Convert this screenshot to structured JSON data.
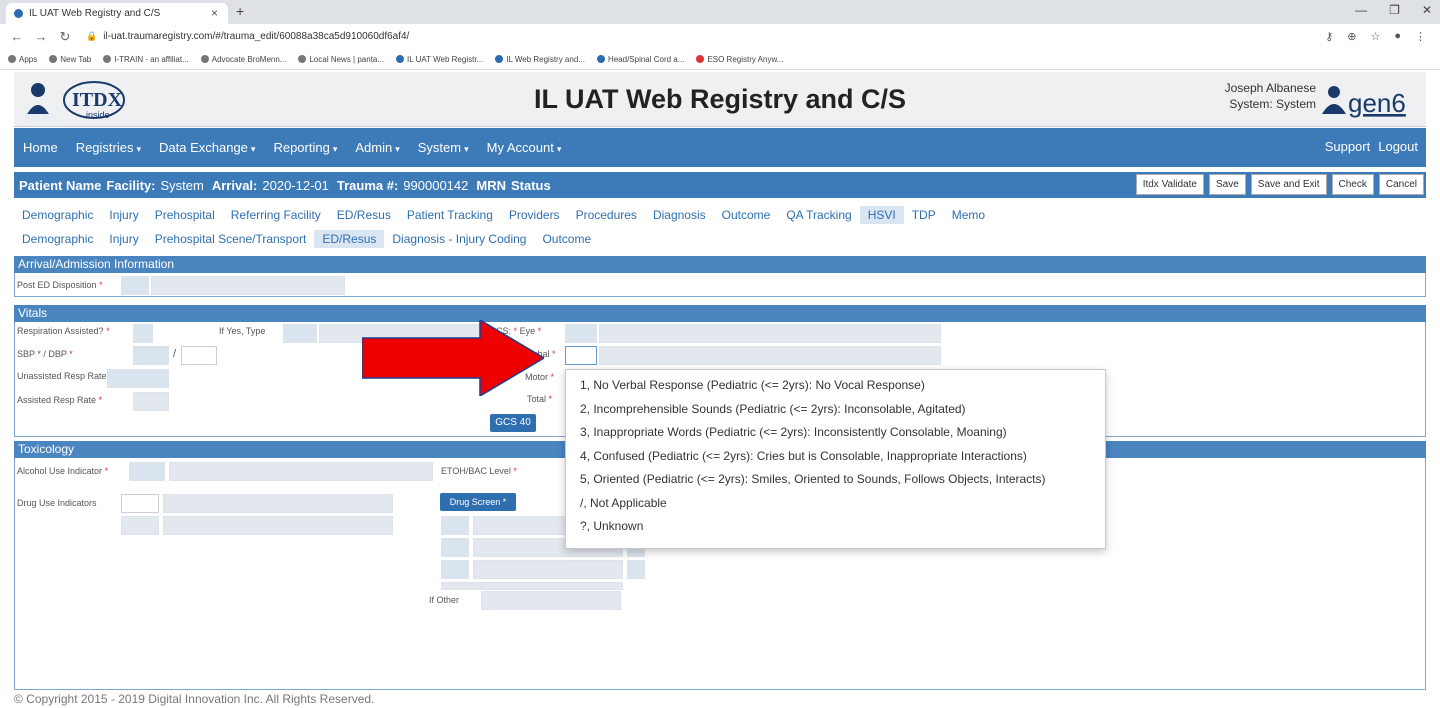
{
  "browser": {
    "tab_title": "IL UAT Web Registry and C/S",
    "tab_close": "×",
    "new_tab": "+",
    "url": "il-uat.traumaregistry.com/#/trauma_edit/60088a38ca5d910060df6af4/",
    "bookmarks": [
      "Apps",
      "New Tab",
      "I-TRAIN - an affiliat...",
      "Advocate BroMenn...",
      "Local News | panta...",
      "IL UAT Web Registr...",
      "IL Web Registry and...",
      "Head/Spinal Cord a...",
      "ESO Registry Anyw..."
    ]
  },
  "header": {
    "title": "IL UAT Web Registry and C/S",
    "user_name": "Joseph Albanese",
    "user_system": "System: System",
    "logo_left_text": "ITDX",
    "logo_left_sub": "inside",
    "logo_right_text": "gen6"
  },
  "mainnav": {
    "items": [
      "Home",
      "Registries",
      "Data Exchange",
      "Reporting",
      "Admin",
      "System",
      "My Account"
    ],
    "support": "Support",
    "logout": "Logout"
  },
  "patient": {
    "name_label": "Patient Name",
    "facility_label": "Facility:",
    "facility_value": "System",
    "arrival_label": "Arrival:",
    "arrival_value": "2020-12-01",
    "trauma_label": "Trauma #:",
    "trauma_value": "990000142",
    "mrn_label": "MRN",
    "status_label": "Status",
    "buttons": [
      "Itdx Validate",
      "Save",
      "Save and Exit",
      "Check",
      "Cancel"
    ]
  },
  "tabs_primary": [
    "Demographic",
    "Injury",
    "Prehospital",
    "Referring Facility",
    "ED/Resus",
    "Patient Tracking",
    "Providers",
    "Procedures",
    "Diagnosis",
    "Outcome",
    "QA Tracking",
    "HSVI",
    "TDP",
    "Memo"
  ],
  "tabs_secondary": [
    "Demographic",
    "Injury",
    "Prehospital Scene/Transport",
    "ED/Resus",
    "Diagnosis - Injury Coding",
    "Outcome"
  ],
  "sections": {
    "arrival": {
      "title": "Arrival/Admission Information",
      "post_ed": "Post ED Disposition"
    },
    "vitals": {
      "title": "Vitals",
      "resp_assisted": "Respiration Assisted?",
      "if_yes_type": "If Yes, Type",
      "sbp_dbp": "SBP * / DBP",
      "slash": "/",
      "unassisted_rr": "Unassisted Resp Rate",
      "assisted_rr": "Assisted Resp Rate",
      "gcs": "GCS:",
      "eye": "Eye",
      "verbal": "Verbal",
      "motor": "Motor",
      "total": "Total",
      "gcs40": "GCS 40"
    },
    "toxicology": {
      "title": "Toxicology",
      "alcohol": "Alcohol Use Indicator",
      "etoh": "ETOH/BAC Level",
      "drug_use": "Drug Use Indicators",
      "drug_screen": "Drug Screen",
      "if_other": "If Other"
    }
  },
  "dropdown": {
    "options": [
      "1, No Verbal Response (Pediatric (<= 2yrs): No Vocal Response)",
      "2, Incomprehensible Sounds (Pediatric (<= 2yrs): Inconsolable, Agitated)",
      "3, Inappropriate Words (Pediatric (<= 2yrs): Inconsistently Consolable, Moaning)",
      "4, Confused (Pediatric (<= 2yrs): Cries but is Consolable, Inappropriate Interactions)",
      "5, Oriented (Pediatric (<= 2yrs): Smiles, Oriented to Sounds, Follows Objects, Interacts)",
      "/, Not Applicable",
      "?, Unknown"
    ]
  },
  "footer": "© Copyright 2015 - 2019 Digital Innovation Inc. All Rights Reserved.",
  "colors": {
    "nav_blue": "#3c7ab8",
    "section_blue": "#4a85c0",
    "arrow_red": "#ee0000",
    "required": "#dd3333"
  }
}
